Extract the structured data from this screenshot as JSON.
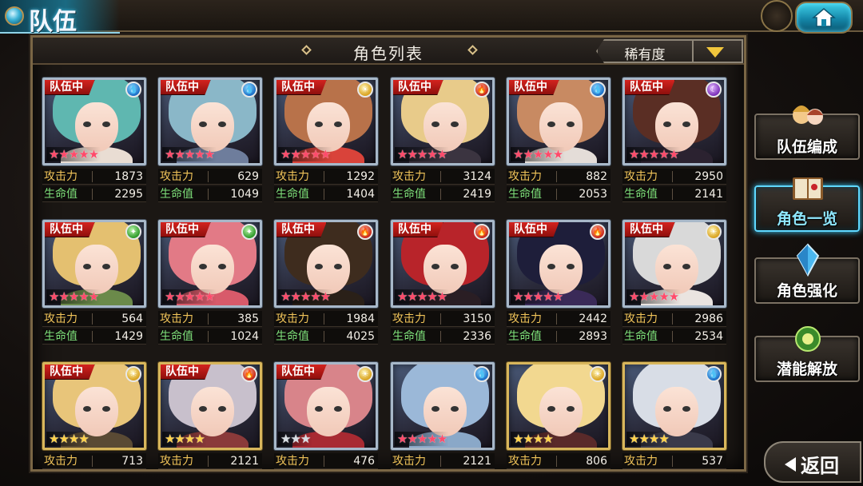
{
  "header": {
    "title": "队伍"
  },
  "list": {
    "title": "角色列表",
    "sort": {
      "selected": "稀有度"
    }
  },
  "labels": {
    "team": "队伍中",
    "atk": "攻击力",
    "hp": "生命值"
  },
  "colors": {
    "accent": "#3cc8f5",
    "badge": "#c8201c",
    "atk_label": "#f2c55a",
    "hp_label": "#7ee07a"
  },
  "characters": [
    {
      "in_team": true,
      "element": "water",
      "stars": 5,
      "star_color": "red",
      "frame": "silver",
      "atk": "1873",
      "hp": "2295",
      "hair": "#5fb7b0",
      "outfit": "#e9ddd3"
    },
    {
      "in_team": true,
      "element": "water",
      "stars": 5,
      "star_color": "red",
      "frame": "silver",
      "atk": "629",
      "hp": "1049",
      "hair": "#8ab7c8",
      "outfit": "#6e7d9c"
    },
    {
      "in_team": true,
      "element": "light",
      "stars": 5,
      "star_color": "red",
      "frame": "silver",
      "atk": "1292",
      "hp": "1404",
      "hair": "#b8724a",
      "outfit": "#d9433a"
    },
    {
      "in_team": true,
      "element": "fire",
      "stars": 5,
      "star_color": "red",
      "frame": "silver",
      "atk": "3124",
      "hp": "2419",
      "hair": "#e8cb8a",
      "outfit": "#3b3440"
    },
    {
      "in_team": true,
      "element": "water",
      "stars": 5,
      "star_color": "red",
      "frame": "silver",
      "atk": "882",
      "hp": "2053",
      "hair": "#c88a62",
      "outfit": "#e4ddd8"
    },
    {
      "in_team": true,
      "element": "dark",
      "stars": 5,
      "star_color": "red",
      "frame": "silver",
      "atk": "2950",
      "hp": "2141",
      "hair": "#5a2e24",
      "outfit": "#2b2230"
    },
    {
      "in_team": true,
      "element": "wind",
      "stars": 5,
      "star_color": "red",
      "frame": "silver",
      "atk": "564",
      "hp": "1429",
      "hair": "#e4c070",
      "outfit": "#6b8a4a"
    },
    {
      "in_team": true,
      "element": "wind",
      "stars": 5,
      "star_color": "red",
      "frame": "silver",
      "atk": "385",
      "hp": "1024",
      "hair": "#e27a86",
      "outfit": "#d85a6a"
    },
    {
      "in_team": true,
      "element": "fire",
      "stars": 5,
      "star_color": "red",
      "frame": "silver",
      "atk": "1984",
      "hp": "4025",
      "hair": "#3e2c1e",
      "outfit": "#2a2018"
    },
    {
      "in_team": true,
      "element": "fire",
      "stars": 5,
      "star_color": "red",
      "frame": "silver",
      "atk": "3150",
      "hp": "2336",
      "hair": "#b8242a",
      "outfit": "#2a1e24"
    },
    {
      "in_team": true,
      "element": "fire",
      "stars": 5,
      "star_color": "red",
      "frame": "silver",
      "atk": "2442",
      "hp": "2893",
      "hair": "#1e1e3a",
      "outfit": "#3a2a58"
    },
    {
      "in_team": true,
      "element": "light",
      "stars": 5,
      "star_color": "red",
      "frame": "silver",
      "atk": "2986",
      "hp": "2534",
      "hair": "#d9d9d9",
      "outfit": "#eae4e0"
    },
    {
      "in_team": true,
      "element": "light",
      "stars": 4,
      "star_color": "gold",
      "frame": "gold",
      "atk": "713",
      "hp": "",
      "hair": "#e8c57a",
      "outfit": "#5a4a34"
    },
    {
      "in_team": true,
      "element": "fire",
      "stars": 4,
      "star_color": "gold",
      "frame": "gold",
      "atk": "2121",
      "hp": "",
      "hair": "#c8c0cc",
      "outfit": "#8a3a3a"
    },
    {
      "in_team": true,
      "element": "light",
      "stars": 3,
      "star_color": "silver",
      "frame": "silver",
      "atk": "476",
      "hp": "",
      "hair": "#d8848a",
      "outfit": "#a82a32"
    },
    {
      "in_team": false,
      "element": "water",
      "stars": 5,
      "star_color": "red",
      "frame": "silver",
      "atk": "2121",
      "hp": "",
      "hair": "#9bb8d8",
      "outfit": "#8aa8c8"
    },
    {
      "in_team": false,
      "element": "light",
      "stars": 4,
      "star_color": "gold",
      "frame": "gold",
      "atk": "806",
      "hp": "",
      "hair": "#f2d890",
      "outfit": "#5a2a2a"
    },
    {
      "in_team": false,
      "element": "water",
      "stars": 4,
      "star_color": "gold",
      "frame": "gold",
      "atk": "537",
      "hp": "",
      "hair": "#d8dde6",
      "outfit": "#3a3a4a"
    }
  ],
  "sidebar": {
    "items": [
      {
        "label": "队伍编成",
        "icon": "team-faces-icon",
        "active": false
      },
      {
        "label": "角色一览",
        "icon": "book-icon",
        "active": true
      },
      {
        "label": "角色强化",
        "icon": "crystal-icon",
        "active": false
      },
      {
        "label": "潜能解放",
        "icon": "orb-icon",
        "active": false
      }
    ]
  },
  "footer": {
    "back_label": "返回"
  }
}
